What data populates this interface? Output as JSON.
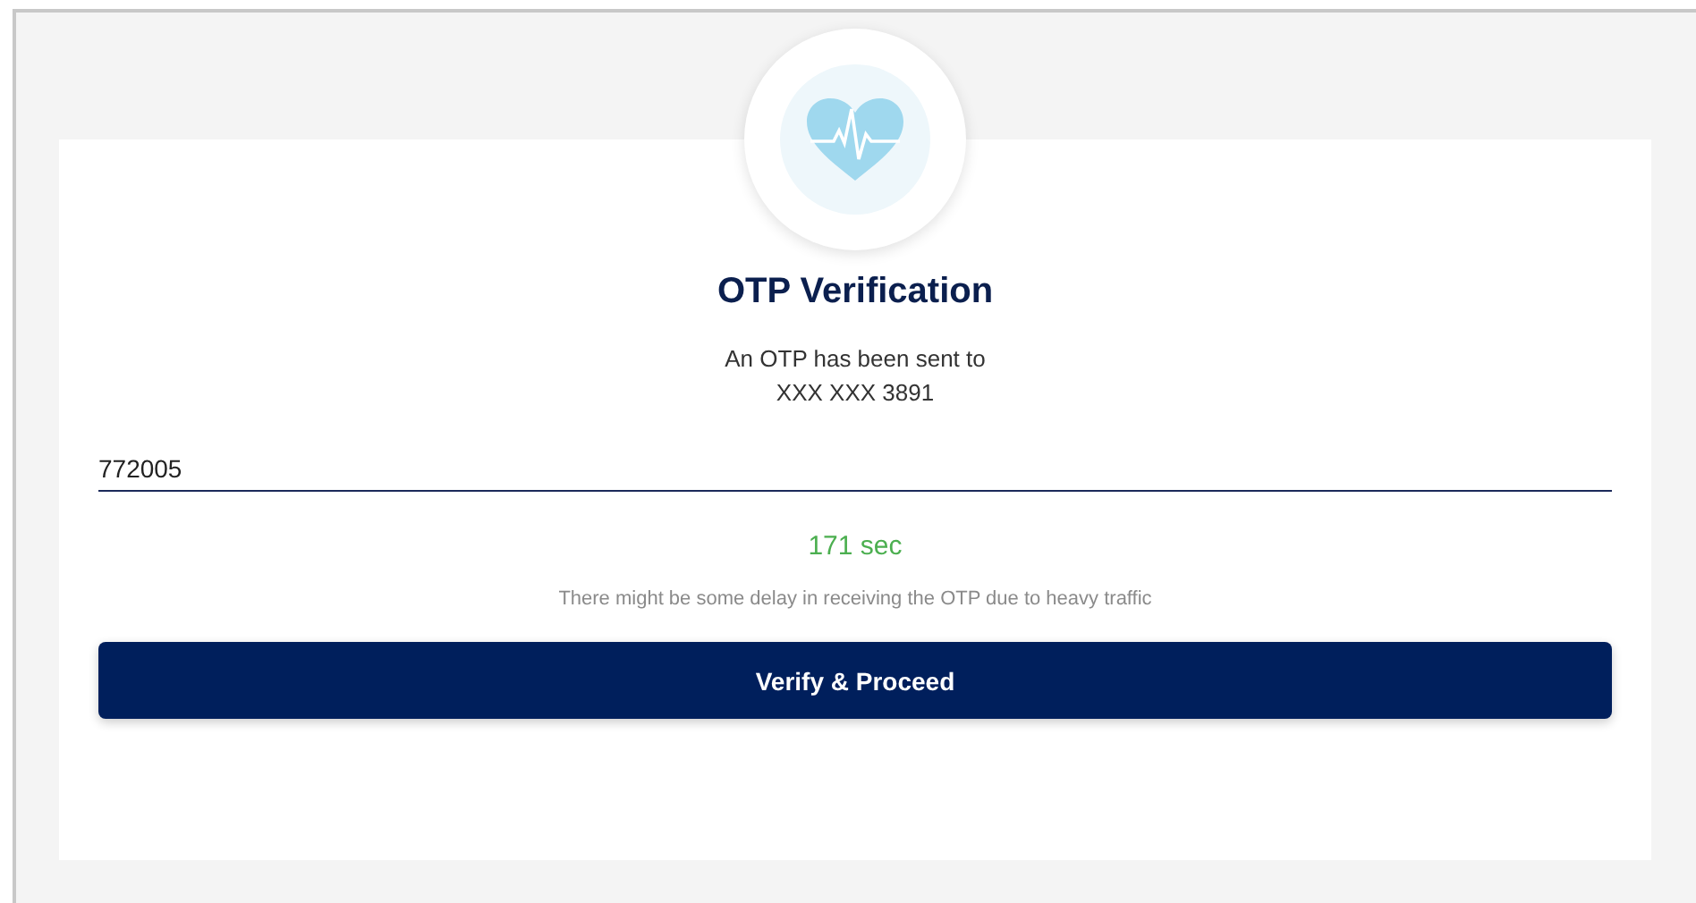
{
  "title": "OTP Verification",
  "message": [
    "An OTP has been sent to",
    "XXX XXX 3891"
  ],
  "otp_field": {
    "value": "772005"
  },
  "timer": "171 sec",
  "note": "There might be some delay in receiving the OTP due to heavy traffic",
  "button": "Verify & Proceed"
}
